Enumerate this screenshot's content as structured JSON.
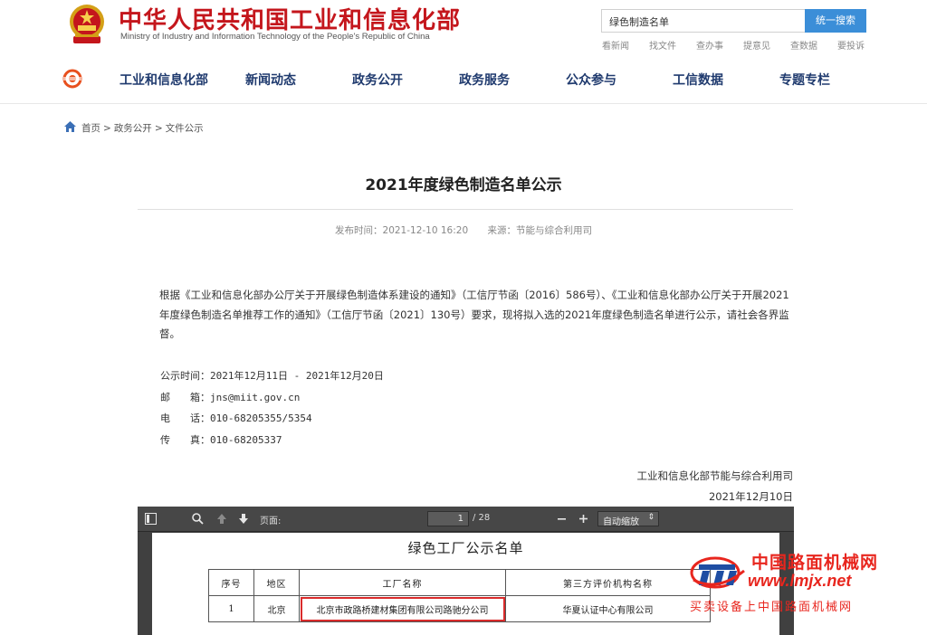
{
  "header": {
    "site_title": "中华人民共和国工业和信息化部",
    "site_subtitle": "Ministry of Industry and Information Technology of the People's Republic of China",
    "search": {
      "value": "绿色制造名单",
      "button": "统一搜索"
    },
    "quick_links": [
      "看新闻",
      "找文件",
      "查办事",
      "提意见",
      "查数据",
      "要投诉"
    ],
    "nav": [
      "工业和信息化部",
      "新闻动态",
      "政务公开",
      "政务服务",
      "公众参与",
      "工信数据",
      "专题专栏"
    ]
  },
  "breadcrumb": [
    "首页",
    ">",
    "政务公开",
    ">",
    "文件公示"
  ],
  "article": {
    "title": "2021年度绿色制造名单公示",
    "meta": {
      "published": "发布时间：2021-12-10 16:20",
      "source": "来源：节能与综合利用司"
    },
    "paragraph": "根据《工业和信息化部办公厅关于开展绿色制造体系建设的通知》（工信厅节函〔2016〕586号）、《工业和信息化部办公厅关于开展2021年度绿色制造名单推荐工作的通知》（工信厅节函〔2021〕130号）要求，现将拟入选的2021年度绿色制造名单进行公示，请社会各界监督。",
    "contact": {
      "period": "公示时间：2021年12月11日 - 2021年12月20日",
      "email": "邮　　箱：jns@miit.gov.cn",
      "phone": "电　　话：010-68205355/5354",
      "fax": "传　　真：010-68205337"
    },
    "signature": {
      "department": "工业和信息化部节能与综合利用司",
      "date": "2021年12月10日"
    }
  },
  "pdf_viewer": {
    "page_label": "页面:",
    "current_page": "1",
    "total_pages": "/ 28",
    "zoom": "自动缩放",
    "document_heading": "绿色工厂公示名单",
    "table": {
      "headers": [
        "序号",
        "地区",
        "工厂名称",
        "第三方评价机构名称"
      ],
      "rows": [
        [
          "1",
          "北京",
          "北京市政路桥建材集团有限公司路驰分公司",
          "华夏认证中心有限公司"
        ]
      ]
    }
  },
  "watermark": {
    "name": "中国路面机械网",
    "url": "www.lmjx.net",
    "slogan": "买卖设备上中国路面机械网"
  },
  "colors": {
    "brand_red": "#c4161c",
    "nav_blue": "#1f3a6e",
    "search_button": "#3b8ed8",
    "highlight": "#d92b2b",
    "watermark_red": "#e8261e"
  }
}
